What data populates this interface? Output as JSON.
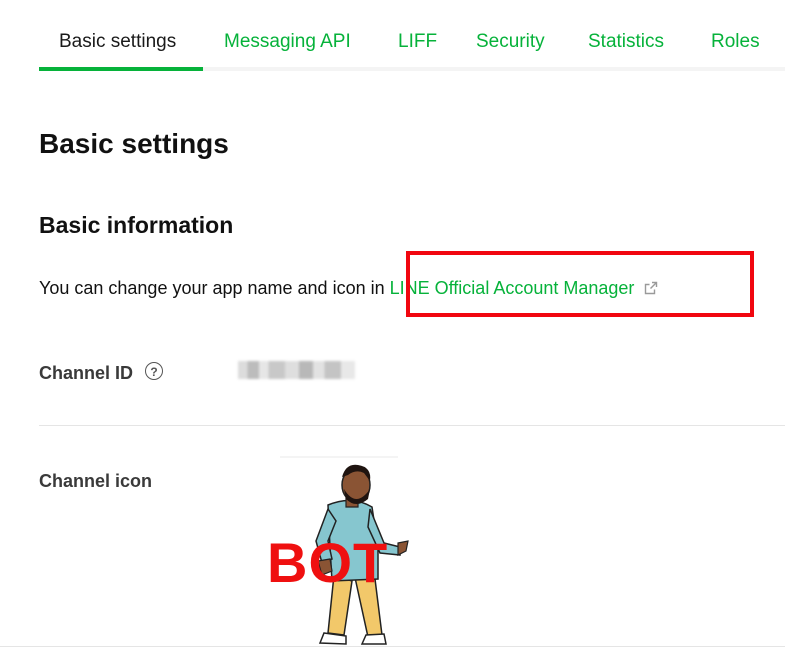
{
  "tabs": [
    {
      "label": "Basic settings",
      "active": true
    },
    {
      "label": "Messaging API"
    },
    {
      "label": "LIFF"
    },
    {
      "label": "Security"
    },
    {
      "label": "Statistics"
    },
    {
      "label": "Roles"
    }
  ],
  "page": {
    "title": "Basic settings",
    "section_title": "Basic information",
    "info_text": "You can change your app name and icon in ",
    "info_link": "LINE Official Account Manager",
    "channel_id_label": "Channel ID",
    "help_glyph": "?",
    "channel_icon_label": "Channel icon",
    "channel_icon_text": "BOT"
  },
  "icons": {
    "external_link": "external-link-icon",
    "help": "question-circle-icon"
  },
  "colors": {
    "accent": "#06b23a",
    "highlight": "#f1060f",
    "bot_text": "#ef1010"
  }
}
